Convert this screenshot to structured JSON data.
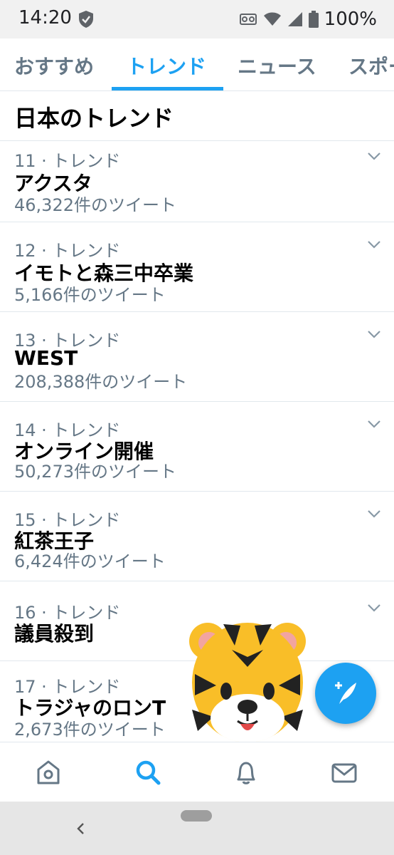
{
  "status_bar": {
    "time": "14:20",
    "battery_pct": "100%",
    "icons": [
      "shield-icon",
      "voicemail-icon",
      "wifi-icon",
      "signal-icon",
      "battery-icon"
    ]
  },
  "tabs": [
    {
      "label": "おすすめ",
      "active": false
    },
    {
      "label": "トレンド",
      "active": true
    },
    {
      "label": "ニュース",
      "active": false
    },
    {
      "label": "スポー",
      "active": false
    }
  ],
  "section": {
    "title": "日本のトレンド"
  },
  "trends": [
    {
      "meta": "11 · トレンド",
      "name": "アクスタ",
      "count": "46,322件のツイート"
    },
    {
      "meta": "12 · トレンド",
      "name": "イモトと森三中卒業",
      "count": "5,166件のツイート"
    },
    {
      "meta": "13 · トレンド",
      "name": "WEST",
      "count": "208,388件のツイート"
    },
    {
      "meta": "14 · トレンド",
      "name": "オンライン開催",
      "count": "50,273件のツイート"
    },
    {
      "meta": "15 · トレンド",
      "name": "紅茶王子",
      "count": "6,424件のツイート"
    },
    {
      "meta": "16 · トレンド",
      "name": "議員殺到",
      "count": ""
    },
    {
      "meta": "17 · トレンド",
      "name": "トラジャのロンT",
      "count": "2,673件のツイート"
    }
  ],
  "fab": {
    "icon": "compose-tweet-icon",
    "color": "#1da1f2"
  },
  "bottom_nav": [
    {
      "name": "home",
      "icon": "home-icon",
      "active": false
    },
    {
      "name": "search",
      "icon": "search-icon",
      "active": true
    },
    {
      "name": "notifications",
      "icon": "bell-icon",
      "active": false
    },
    {
      "name": "messages",
      "icon": "mail-icon",
      "active": false
    }
  ],
  "colors": {
    "accent": "#1da1f2",
    "secondary_text": "#657786",
    "divider": "#e1e8ed"
  }
}
